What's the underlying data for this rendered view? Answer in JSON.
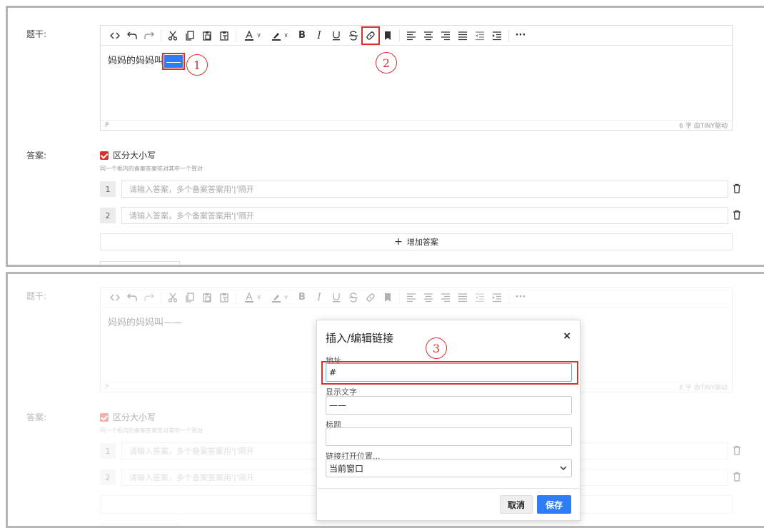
{
  "colors": {
    "accent": "#2f7df6",
    "annotation": "#d9302c",
    "border": "#b5b5b5"
  },
  "form": {
    "stem_label": "题干:",
    "answer_label": "答案:",
    "case_sensitive_label": "区分大小写",
    "case_sensitive_checked": true,
    "hint": "同一个框内的备案答案答对其中一个算对",
    "answers": [
      {
        "num": "1",
        "placeholder": "请输入答案，多个备案答案用'|'隔开"
      },
      {
        "num": "2",
        "placeholder": "请输入答案，多个备案答案用'|'隔开"
      }
    ],
    "add_answer": "增加答案"
  },
  "editor": {
    "toolbar": [
      "source-code-icon",
      "undo-icon",
      "redo-icon",
      "cut-icon",
      "copy-icon",
      "paste-icon",
      "paste-text-icon",
      "font-color-icon",
      "highlight-color-icon",
      "bold-icon",
      "italic-icon",
      "underline-icon",
      "strikethrough-icon",
      "link-icon",
      "bookmark-icon",
      "align-left-icon",
      "align-center-icon",
      "align-right-icon",
      "justify-icon",
      "outdent-icon",
      "indent-icon",
      "more-icon"
    ],
    "bold": "B",
    "italic": "I",
    "more": "···",
    "content_text": "妈妈的妈妈叫",
    "blank_dim": "——",
    "status_path": "P",
    "status_right": "6 字 由TINY驱动"
  },
  "annotations": {
    "one": "1",
    "two": "2",
    "three": "3"
  },
  "dialog": {
    "title": "插入/编辑链接",
    "close": "×",
    "url_label": "地址",
    "url_value": "#",
    "text_label": "显示文字",
    "text_value": "——",
    "title_label": "标题",
    "title_value": "",
    "target_label": "链接打开位置...",
    "target_value": "当前窗口",
    "cancel": "取消",
    "save": "保存"
  }
}
